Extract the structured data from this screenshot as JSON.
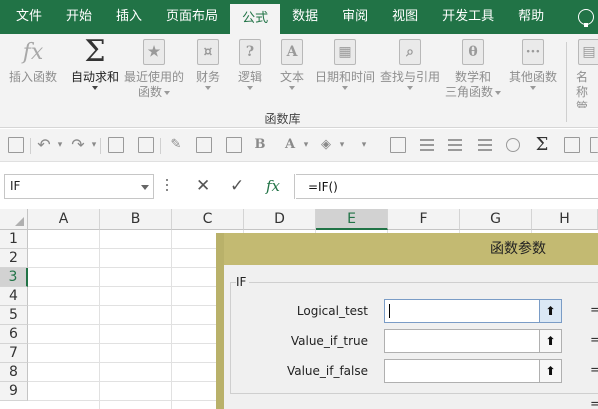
{
  "menu": {
    "tabs": [
      {
        "label": "文件",
        "active": false
      },
      {
        "label": "开始",
        "active": false
      },
      {
        "label": "插入",
        "active": false
      },
      {
        "label": "页面布局",
        "active": false
      },
      {
        "label": "公式",
        "active": true
      },
      {
        "label": "数据",
        "active": false
      },
      {
        "label": "审阅",
        "active": false
      },
      {
        "label": "视图",
        "active": false
      },
      {
        "label": "开发工具",
        "active": false
      },
      {
        "label": "帮助",
        "active": false
      }
    ]
  },
  "ribbon": {
    "buttons": [
      {
        "line1": "插入函数",
        "line2": "",
        "icon": "function-icon",
        "enabled": false
      },
      {
        "line1": "自动求和",
        "line2": "",
        "icon": "sigma-icon",
        "enabled": true
      },
      {
        "line1": "最近使用的",
        "line2": "函数",
        "icon": "star-book-icon",
        "enabled": false
      },
      {
        "line1": "财务",
        "line2": "",
        "icon": "financial-book-icon",
        "enabled": false
      },
      {
        "line1": "逻辑",
        "line2": "",
        "icon": "logical-book-icon",
        "enabled": false
      },
      {
        "line1": "文本",
        "line2": "",
        "icon": "text-book-icon",
        "enabled": false
      },
      {
        "line1": "日期和时间",
        "line2": "",
        "icon": "calendar-book-icon",
        "enabled": false
      },
      {
        "line1": "查找与引用",
        "line2": "",
        "icon": "lookup-book-icon",
        "enabled": false
      },
      {
        "line1": "数学和",
        "line2": "三角函数",
        "icon": "math-book-icon",
        "enabled": false
      },
      {
        "line1": "其他函数",
        "line2": "",
        "icon": "more-book-icon",
        "enabled": false
      },
      {
        "line1": "名称",
        "line2": "管理",
        "icon": "name-manager-icon",
        "enabled": false
      }
    ],
    "group_label": "函数库"
  },
  "formula_bar": {
    "name_box": "IF",
    "formula": "=IF()"
  },
  "grid": {
    "columns": [
      "A",
      "B",
      "C",
      "D",
      "E",
      "F",
      "G",
      "H"
    ],
    "selected_column": "E",
    "rows": [
      "1",
      "2",
      "3",
      "4",
      "5",
      "6",
      "7",
      "8",
      "9"
    ],
    "selected_row": "3"
  },
  "dialog": {
    "title": "函数参数",
    "function_name": "IF",
    "args": [
      {
        "label": "Logical_test",
        "value": "",
        "focused": true
      },
      {
        "label": "Value_if_true",
        "value": "",
        "focused": false
      },
      {
        "label": "Value_if_false",
        "value": "",
        "focused": false
      }
    ],
    "equals": "="
  }
}
